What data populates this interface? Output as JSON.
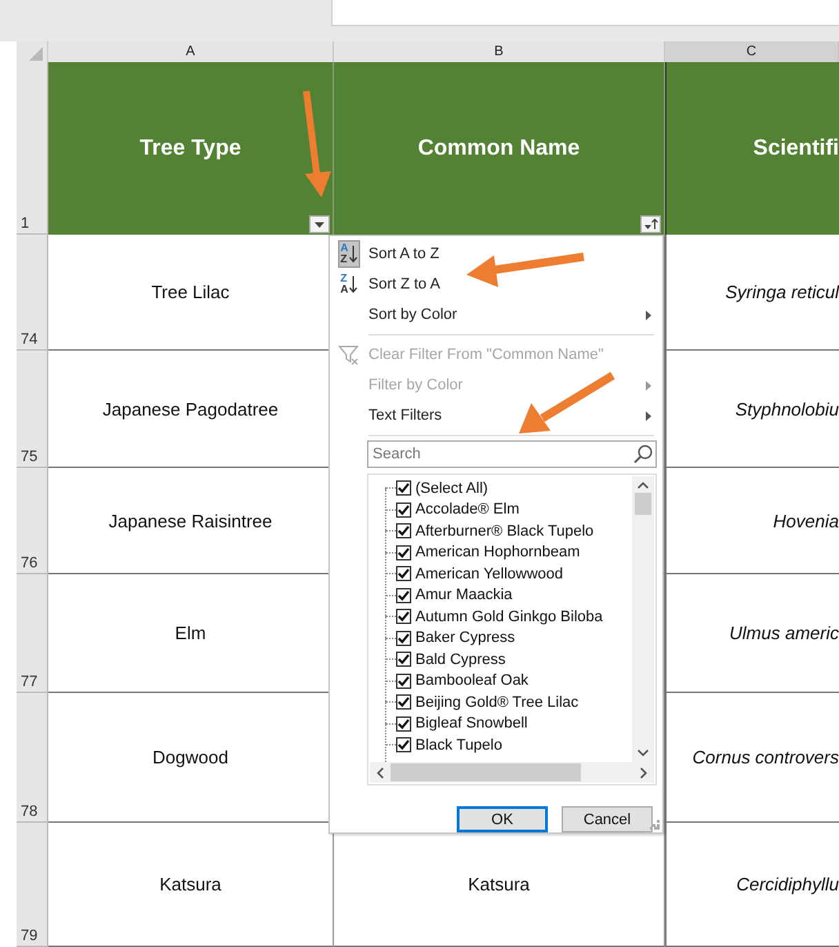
{
  "column_headers": [
    {
      "label": "A",
      "selected": false
    },
    {
      "label": "B",
      "selected": false
    },
    {
      "label": "C",
      "selected": true
    }
  ],
  "header_row": {
    "number": "1",
    "cells": [
      {
        "text": "Tree Type",
        "kind": "dropdown"
      },
      {
        "text": "Common Name",
        "kind": "sorted"
      },
      {
        "text": "Scientifi",
        "kind": "plain"
      }
    ]
  },
  "rows": [
    {
      "number": "74",
      "col_a": "Tree Lilac",
      "col_c": "Syringa reticul"
    },
    {
      "number": "75",
      "col_a": "Japanese Pagodatree",
      "col_c": "Styphnolobiu"
    },
    {
      "number": "76",
      "col_a": "Japanese Raisintree",
      "col_c": "Hovenia"
    },
    {
      "number": "77",
      "col_a": "Elm",
      "col_c": "Ulmus americ"
    },
    {
      "number": "78",
      "col_a": "Dogwood",
      "col_c": "Cornus controvers"
    },
    {
      "number": "79",
      "col_a": "Katsura",
      "col_b": "Katsura",
      "col_c": "Cercidiphyllu"
    }
  ],
  "filter_menu": {
    "groups": [
      [
        {
          "label": "Sort A to Z",
          "kind": "sort",
          "icon_letters": [
            "A",
            "Z"
          ],
          "active": true,
          "disabled": false,
          "submenu": false
        },
        {
          "label": "Sort Z to A",
          "kind": "sort",
          "icon_letters": [
            "Z",
            "A"
          ],
          "active": false,
          "disabled": false,
          "submenu": false
        },
        {
          "label": "Sort by Color",
          "kind": "plain",
          "active": false,
          "disabled": false,
          "submenu": true
        }
      ],
      [
        {
          "label": "Clear Filter From \"Common Name\"",
          "kind": "clear_filter",
          "active": false,
          "disabled": true,
          "submenu": false
        },
        {
          "label": "Filter by Color",
          "kind": "plain",
          "active": false,
          "disabled": true,
          "submenu": true
        },
        {
          "label": "Text Filters",
          "kind": "plain",
          "active": false,
          "disabled": false,
          "submenu": true
        }
      ]
    ],
    "search": {
      "placeholder": "Search"
    },
    "values": [
      {
        "label": "(Select All)",
        "checked": true
      },
      {
        "label": "Accolade® Elm",
        "checked": true
      },
      {
        "label": "Afterburner® Black Tupelo",
        "checked": true
      },
      {
        "label": "American Hophornbeam",
        "checked": true
      },
      {
        "label": "American Yellowwood",
        "checked": true
      },
      {
        "label": "Amur Maackia",
        "checked": true
      },
      {
        "label": "Autumn Gold Ginkgo Biloba",
        "checked": true
      },
      {
        "label": "Baker Cypress",
        "checked": true
      },
      {
        "label": "Bald Cypress",
        "checked": true
      },
      {
        "label": "Bambooleaf Oak",
        "checked": true
      },
      {
        "label": "Beijing Gold® Tree Lilac",
        "checked": true
      },
      {
        "label": "Bigleaf Snowbell",
        "checked": true
      },
      {
        "label": "Black Tupelo",
        "checked": true
      }
    ],
    "buttons": [
      {
        "label": "OK",
        "default": true
      },
      {
        "label": "Cancel",
        "default": false
      }
    ]
  }
}
